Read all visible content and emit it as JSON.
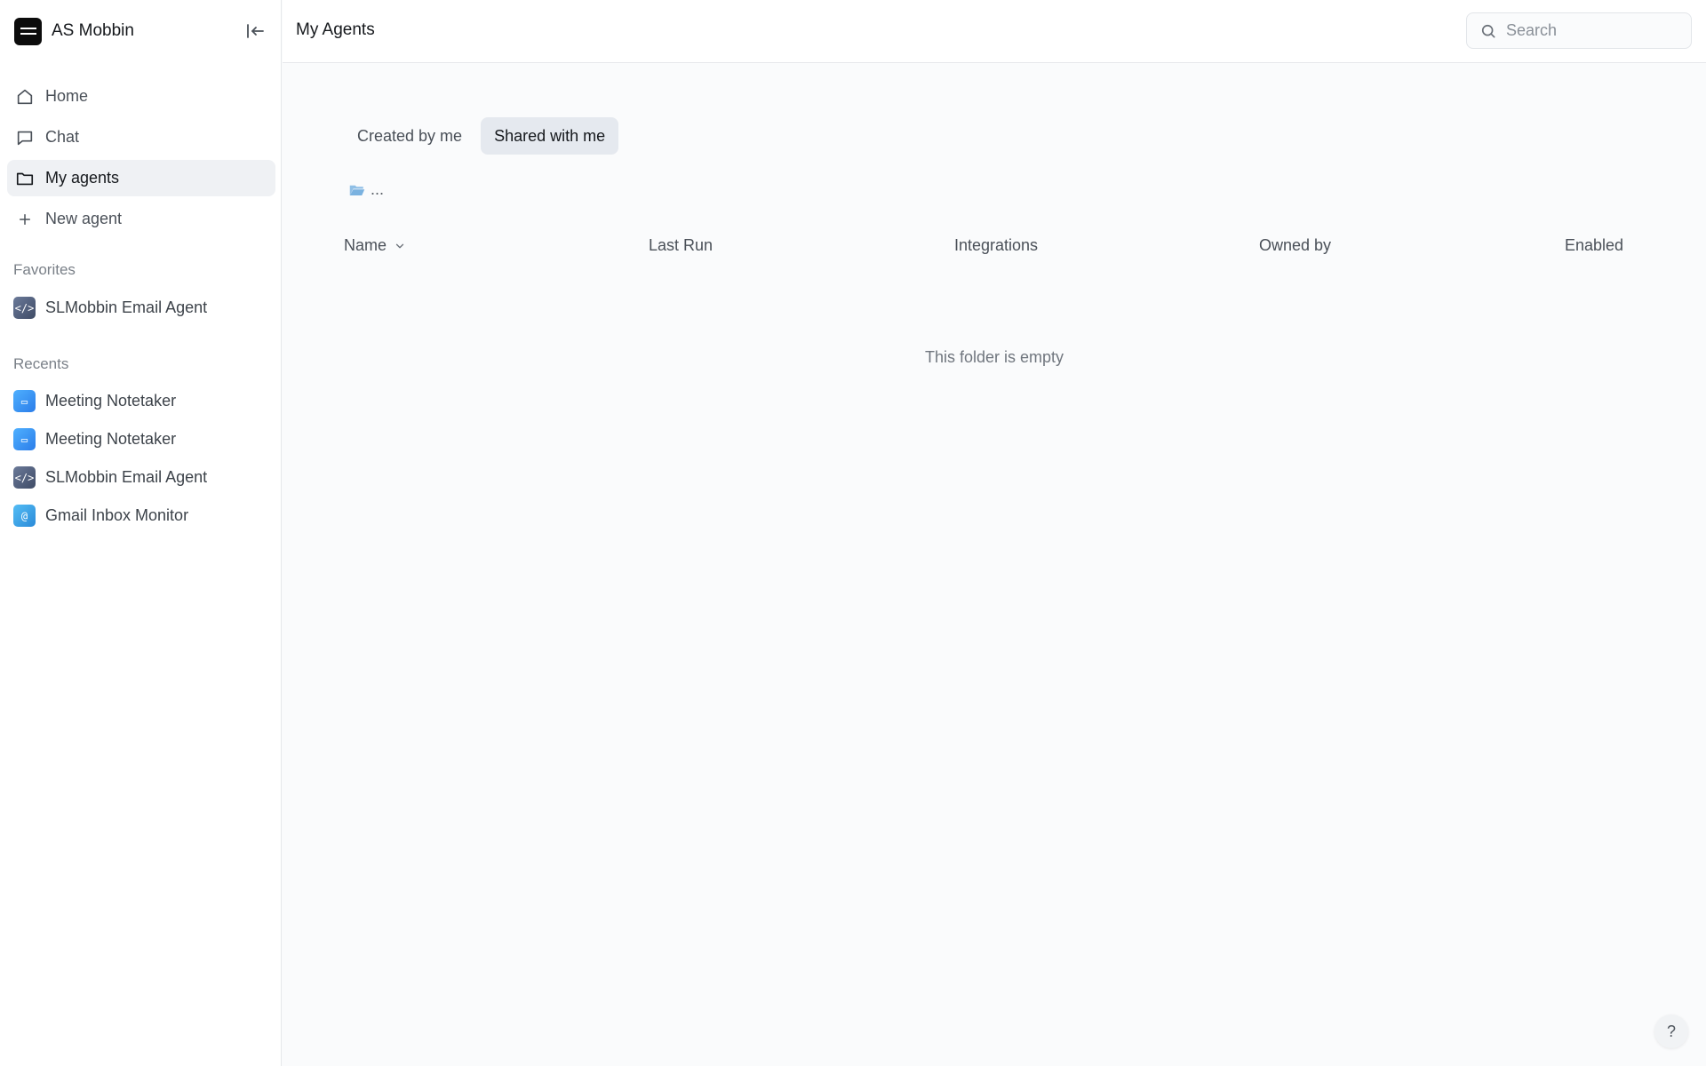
{
  "workspace": {
    "name": "AS Mobbin"
  },
  "nav": {
    "items": [
      {
        "label": "Home",
        "icon": "home-icon"
      },
      {
        "label": "Chat",
        "icon": "chat-bubble-icon"
      },
      {
        "label": "My agents",
        "icon": "folder-icon",
        "active": true
      },
      {
        "label": "New agent",
        "icon": "plus-icon"
      }
    ]
  },
  "favorites": {
    "label": "Favorites",
    "items": [
      {
        "label": "SLMobbin Email Agent",
        "icon": "code-icon"
      }
    ]
  },
  "recents": {
    "label": "Recents",
    "items": [
      {
        "label": "Meeting Notetaker",
        "icon": "meeting-icon"
      },
      {
        "label": "Meeting Notetaker",
        "icon": "meeting-icon"
      },
      {
        "label": "SLMobbin Email Agent",
        "icon": "code-icon"
      },
      {
        "label": "Gmail Inbox Monitor",
        "icon": "at-sign-icon"
      }
    ]
  },
  "header": {
    "title": "My Agents",
    "search_placeholder": "Search"
  },
  "tabs": [
    {
      "label": "Created by me",
      "active": false
    },
    {
      "label": "Shared with me",
      "active": true
    }
  ],
  "breadcrumb": {
    "text": "..."
  },
  "table": {
    "columns": [
      "Name",
      "Last Run",
      "Integrations",
      "Owned by",
      "Enabled"
    ],
    "empty_message": "This folder is empty"
  },
  "help": {
    "label": "?"
  },
  "colors": {
    "active_bg": "#eff1f4",
    "tab_active_bg": "#e5e9ef",
    "folder_accent": "#8fbfe6"
  }
}
